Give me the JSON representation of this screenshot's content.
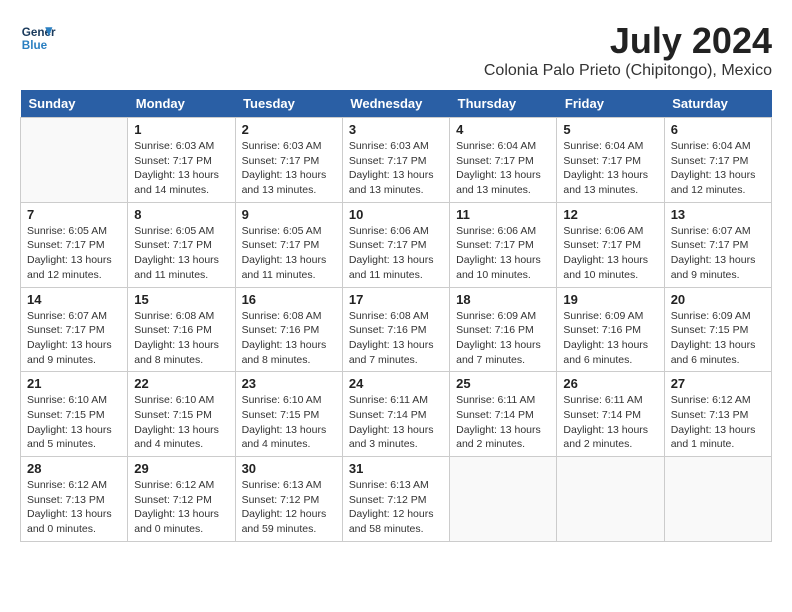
{
  "header": {
    "logo_line1": "General",
    "logo_line2": "Blue",
    "month_year": "July 2024",
    "location": "Colonia Palo Prieto (Chipitongo), Mexico"
  },
  "weekdays": [
    "Sunday",
    "Monday",
    "Tuesday",
    "Wednesday",
    "Thursday",
    "Friday",
    "Saturday"
  ],
  "weeks": [
    [
      {
        "day": "",
        "info": ""
      },
      {
        "day": "1",
        "info": "Sunrise: 6:03 AM\nSunset: 7:17 PM\nDaylight: 13 hours\nand 14 minutes."
      },
      {
        "day": "2",
        "info": "Sunrise: 6:03 AM\nSunset: 7:17 PM\nDaylight: 13 hours\nand 13 minutes."
      },
      {
        "day": "3",
        "info": "Sunrise: 6:03 AM\nSunset: 7:17 PM\nDaylight: 13 hours\nand 13 minutes."
      },
      {
        "day": "4",
        "info": "Sunrise: 6:04 AM\nSunset: 7:17 PM\nDaylight: 13 hours\nand 13 minutes."
      },
      {
        "day": "5",
        "info": "Sunrise: 6:04 AM\nSunset: 7:17 PM\nDaylight: 13 hours\nand 13 minutes."
      },
      {
        "day": "6",
        "info": "Sunrise: 6:04 AM\nSunset: 7:17 PM\nDaylight: 13 hours\nand 12 minutes."
      }
    ],
    [
      {
        "day": "7",
        "info": "Sunrise: 6:05 AM\nSunset: 7:17 PM\nDaylight: 13 hours\nand 12 minutes."
      },
      {
        "day": "8",
        "info": "Sunrise: 6:05 AM\nSunset: 7:17 PM\nDaylight: 13 hours\nand 11 minutes."
      },
      {
        "day": "9",
        "info": "Sunrise: 6:05 AM\nSunset: 7:17 PM\nDaylight: 13 hours\nand 11 minutes."
      },
      {
        "day": "10",
        "info": "Sunrise: 6:06 AM\nSunset: 7:17 PM\nDaylight: 13 hours\nand 11 minutes."
      },
      {
        "day": "11",
        "info": "Sunrise: 6:06 AM\nSunset: 7:17 PM\nDaylight: 13 hours\nand 10 minutes."
      },
      {
        "day": "12",
        "info": "Sunrise: 6:06 AM\nSunset: 7:17 PM\nDaylight: 13 hours\nand 10 minutes."
      },
      {
        "day": "13",
        "info": "Sunrise: 6:07 AM\nSunset: 7:17 PM\nDaylight: 13 hours\nand 9 minutes."
      }
    ],
    [
      {
        "day": "14",
        "info": "Sunrise: 6:07 AM\nSunset: 7:17 PM\nDaylight: 13 hours\nand 9 minutes."
      },
      {
        "day": "15",
        "info": "Sunrise: 6:08 AM\nSunset: 7:16 PM\nDaylight: 13 hours\nand 8 minutes."
      },
      {
        "day": "16",
        "info": "Sunrise: 6:08 AM\nSunset: 7:16 PM\nDaylight: 13 hours\nand 8 minutes."
      },
      {
        "day": "17",
        "info": "Sunrise: 6:08 AM\nSunset: 7:16 PM\nDaylight: 13 hours\nand 7 minutes."
      },
      {
        "day": "18",
        "info": "Sunrise: 6:09 AM\nSunset: 7:16 PM\nDaylight: 13 hours\nand 7 minutes."
      },
      {
        "day": "19",
        "info": "Sunrise: 6:09 AM\nSunset: 7:16 PM\nDaylight: 13 hours\nand 6 minutes."
      },
      {
        "day": "20",
        "info": "Sunrise: 6:09 AM\nSunset: 7:15 PM\nDaylight: 13 hours\nand 6 minutes."
      }
    ],
    [
      {
        "day": "21",
        "info": "Sunrise: 6:10 AM\nSunset: 7:15 PM\nDaylight: 13 hours\nand 5 minutes."
      },
      {
        "day": "22",
        "info": "Sunrise: 6:10 AM\nSunset: 7:15 PM\nDaylight: 13 hours\nand 4 minutes."
      },
      {
        "day": "23",
        "info": "Sunrise: 6:10 AM\nSunset: 7:15 PM\nDaylight: 13 hours\nand 4 minutes."
      },
      {
        "day": "24",
        "info": "Sunrise: 6:11 AM\nSunset: 7:14 PM\nDaylight: 13 hours\nand 3 minutes."
      },
      {
        "day": "25",
        "info": "Sunrise: 6:11 AM\nSunset: 7:14 PM\nDaylight: 13 hours\nand 2 minutes."
      },
      {
        "day": "26",
        "info": "Sunrise: 6:11 AM\nSunset: 7:14 PM\nDaylight: 13 hours\nand 2 minutes."
      },
      {
        "day": "27",
        "info": "Sunrise: 6:12 AM\nSunset: 7:13 PM\nDaylight: 13 hours\nand 1 minute."
      }
    ],
    [
      {
        "day": "28",
        "info": "Sunrise: 6:12 AM\nSunset: 7:13 PM\nDaylight: 13 hours\nand 0 minutes."
      },
      {
        "day": "29",
        "info": "Sunrise: 6:12 AM\nSunset: 7:12 PM\nDaylight: 13 hours\nand 0 minutes."
      },
      {
        "day": "30",
        "info": "Sunrise: 6:13 AM\nSunset: 7:12 PM\nDaylight: 12 hours\nand 59 minutes."
      },
      {
        "day": "31",
        "info": "Sunrise: 6:13 AM\nSunset: 7:12 PM\nDaylight: 12 hours\nand 58 minutes."
      },
      {
        "day": "",
        "info": ""
      },
      {
        "day": "",
        "info": ""
      },
      {
        "day": "",
        "info": ""
      }
    ]
  ]
}
